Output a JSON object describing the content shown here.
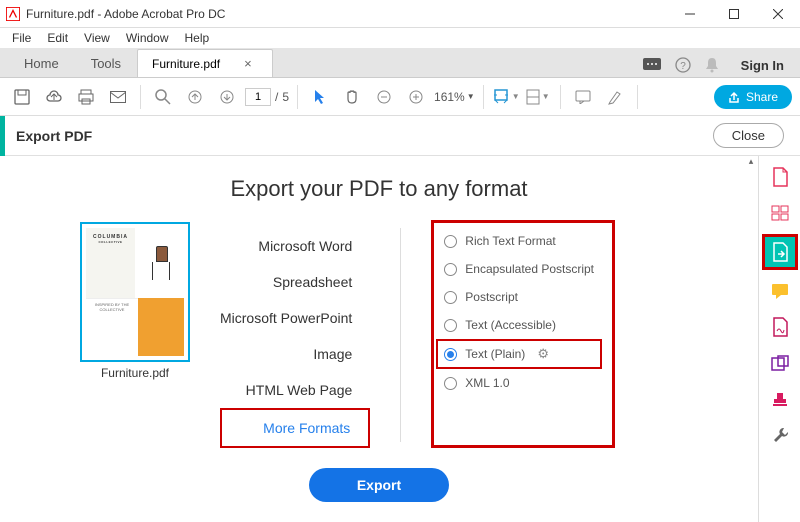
{
  "window": {
    "title": "Furniture.pdf - Adobe Acrobat Pro DC"
  },
  "menu": [
    "File",
    "Edit",
    "View",
    "Window",
    "Help"
  ],
  "tabs": {
    "home": "Home",
    "tools": "Tools",
    "doc": "Furniture.pdf",
    "signin": "Sign In"
  },
  "toolbar": {
    "current_page": "1",
    "total_pages": "5",
    "zoom": "161%",
    "share": "Share"
  },
  "panel": {
    "title": "Export PDF",
    "close": "Close",
    "heading": "Export your PDF to any format",
    "thumb_label": "Furniture.pdf",
    "thumb_brand": "COLUMBIA",
    "thumb_sub": "COLLECTIVE",
    "formats": [
      "Microsoft Word",
      "Spreadsheet",
      "Microsoft PowerPoint",
      "Image",
      "HTML Web Page",
      "More Formats"
    ],
    "options": [
      "Rich Text Format",
      "Encapsulated Postscript",
      "Postscript",
      "Text (Accessible)",
      "Text (Plain)",
      "XML 1.0"
    ],
    "selected_option_index": 4,
    "export_btn": "Export"
  }
}
